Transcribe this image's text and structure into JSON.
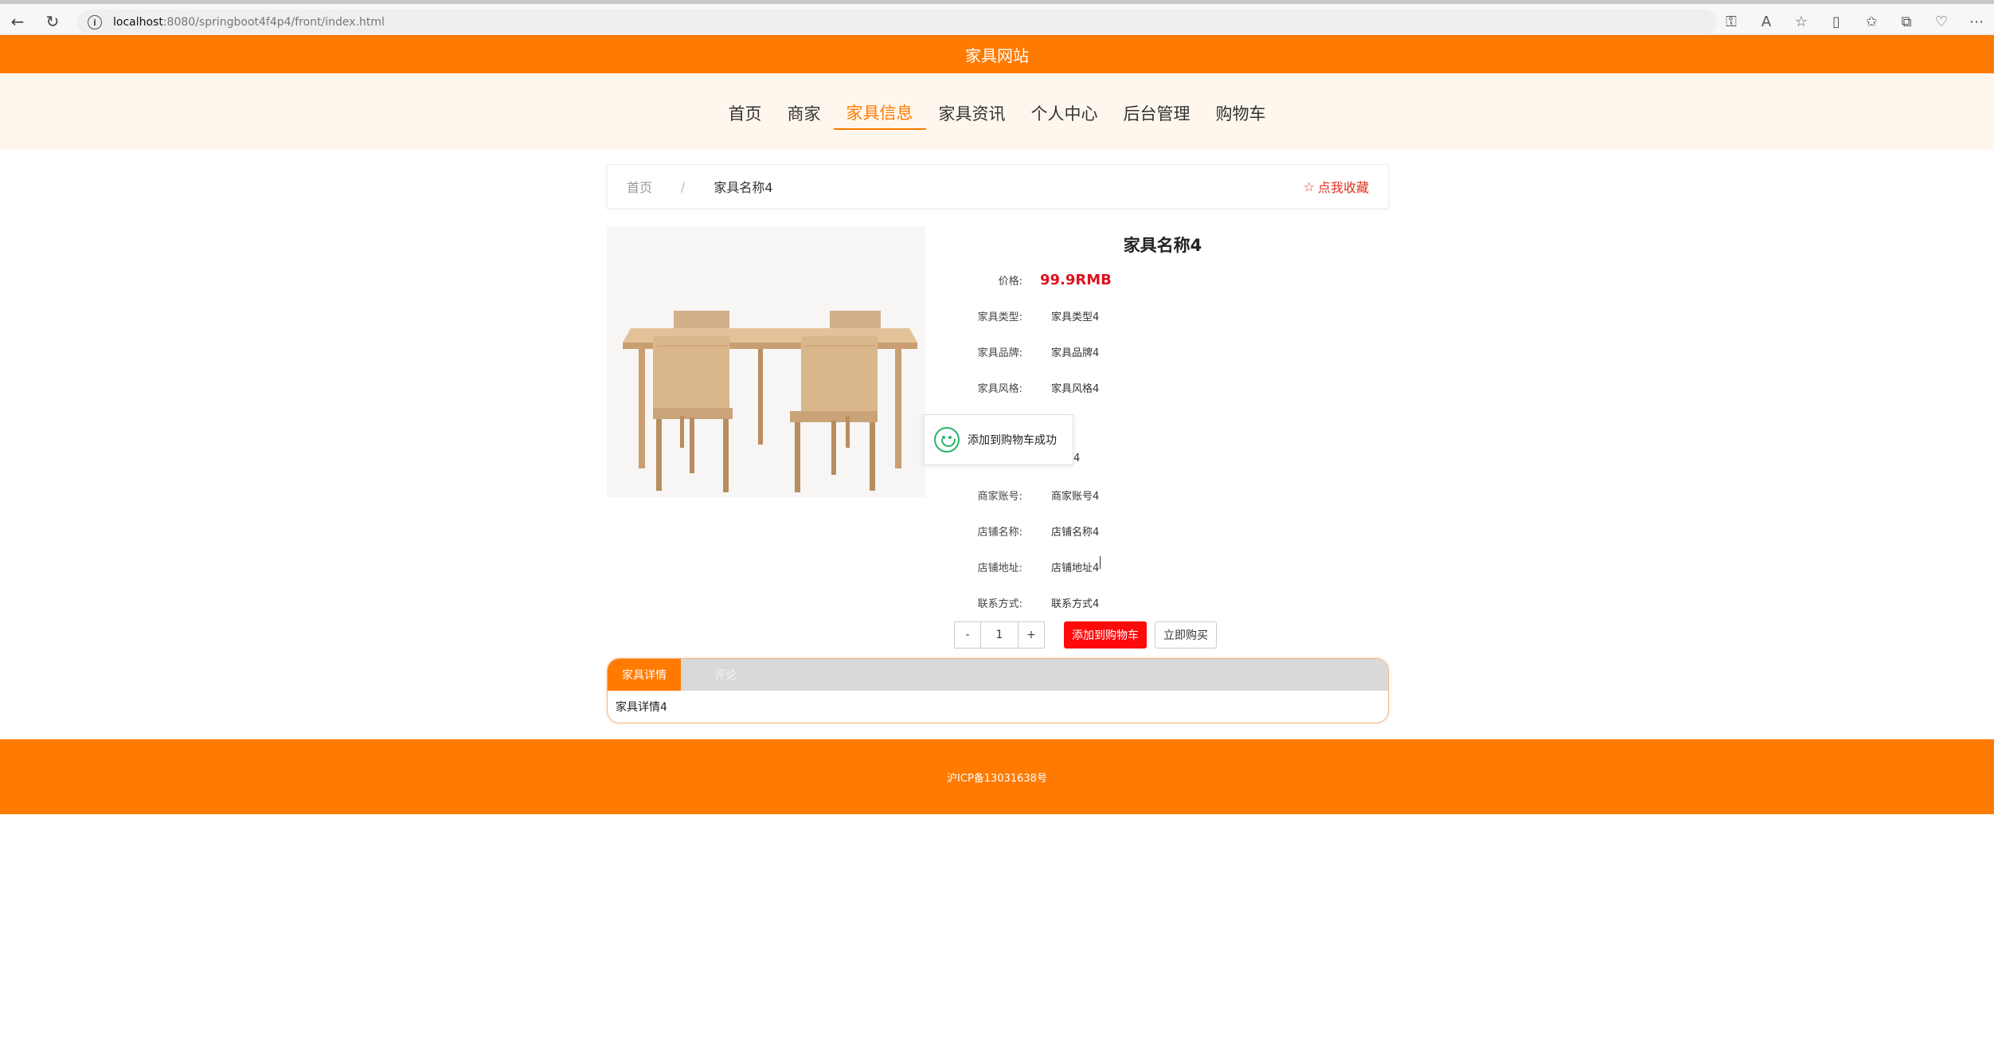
{
  "browser": {
    "url_host": "localhost",
    "url_path": ":8080/springboot4f4p4/front/index.html"
  },
  "site": {
    "title": "家具网站",
    "nav": [
      {
        "label": "首页"
      },
      {
        "label": "商家"
      },
      {
        "label": "家具信息",
        "active": true
      },
      {
        "label": "家具资讯"
      },
      {
        "label": "个人中心"
      },
      {
        "label": "后台管理"
      },
      {
        "label": "购物车"
      }
    ]
  },
  "breadcrumb": {
    "home": "首页",
    "separator": "/",
    "current": "家具名称4",
    "favorite": "点我收藏"
  },
  "product": {
    "name": "家具名称4",
    "price_label": "价格:",
    "price": "99.9RMB",
    "fields": [
      {
        "label": "家具类型:",
        "value": "家具类型4"
      },
      {
        "label": "家具品牌:",
        "value": "家具品牌4"
      },
      {
        "label": "家具风格:",
        "value": "家具风格4"
      },
      {
        "label": "商家账号:",
        "value": "商家账号4"
      },
      {
        "label": "店铺名称:",
        "value": "店铺名称4"
      },
      {
        "label": "店铺地址:",
        "value": "店铺地址4"
      },
      {
        "label": "联系方式:",
        "value": "联系方式4"
      }
    ],
    "hidden_value_fragment": "4"
  },
  "toast": {
    "message": "添加到购物车成功"
  },
  "purchase": {
    "minus": "-",
    "quantity": "1",
    "plus": "+",
    "add_to_cart": "添加到购物车",
    "buy_now": "立即购买"
  },
  "tabs": {
    "items": [
      {
        "label": "家具详情",
        "active": true
      },
      {
        "label": "评论"
      }
    ],
    "content": "家具详情4"
  },
  "footer": {
    "text": "沪ICP备13031638号"
  },
  "colors": {
    "brand": "#ff7a00",
    "price": "#e0101e",
    "cart_button": "#ff0a0a",
    "nav_bg": "#fff7ee"
  }
}
